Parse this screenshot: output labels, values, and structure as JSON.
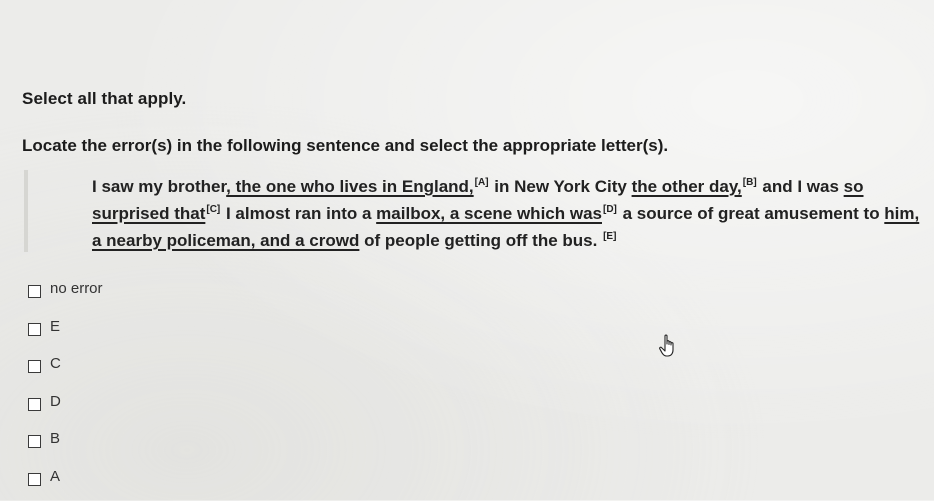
{
  "instruction": "Select all that apply.",
  "prompt": "Locate the error(s) in the following sentence and select the appropriate letter(s).",
  "sentence": {
    "p1": "I saw my brother",
    "u1": ", the one who lives in England,",
    "mA": "[A]",
    "p2": " in New York City ",
    "u2": "the other day,",
    "mB": "[B]",
    "p3": " and I was ",
    "u3": "so surprised that",
    "mC": "[C]",
    "p4": " I almost ran into a ",
    "u4": "mailbox, a scene which was",
    "mD": "[D]",
    "p5": " a source of great amusement to ",
    "u5": "him, a nearby policeman, and a crowd",
    "p6": " of people getting off the bus. ",
    "mE": "[E]"
  },
  "options": [
    {
      "label": "no error",
      "checked": false
    },
    {
      "label": "E",
      "checked": false
    },
    {
      "label": "C",
      "checked": false
    },
    {
      "label": "D",
      "checked": false
    },
    {
      "label": "B",
      "checked": false
    },
    {
      "label": "A",
      "checked": false
    }
  ],
  "icons": {
    "cursor": "hand-pointer-icon",
    "checkbox": "checkbox-icon"
  },
  "colors": {
    "background": "#ececea",
    "text": "#222222"
  }
}
